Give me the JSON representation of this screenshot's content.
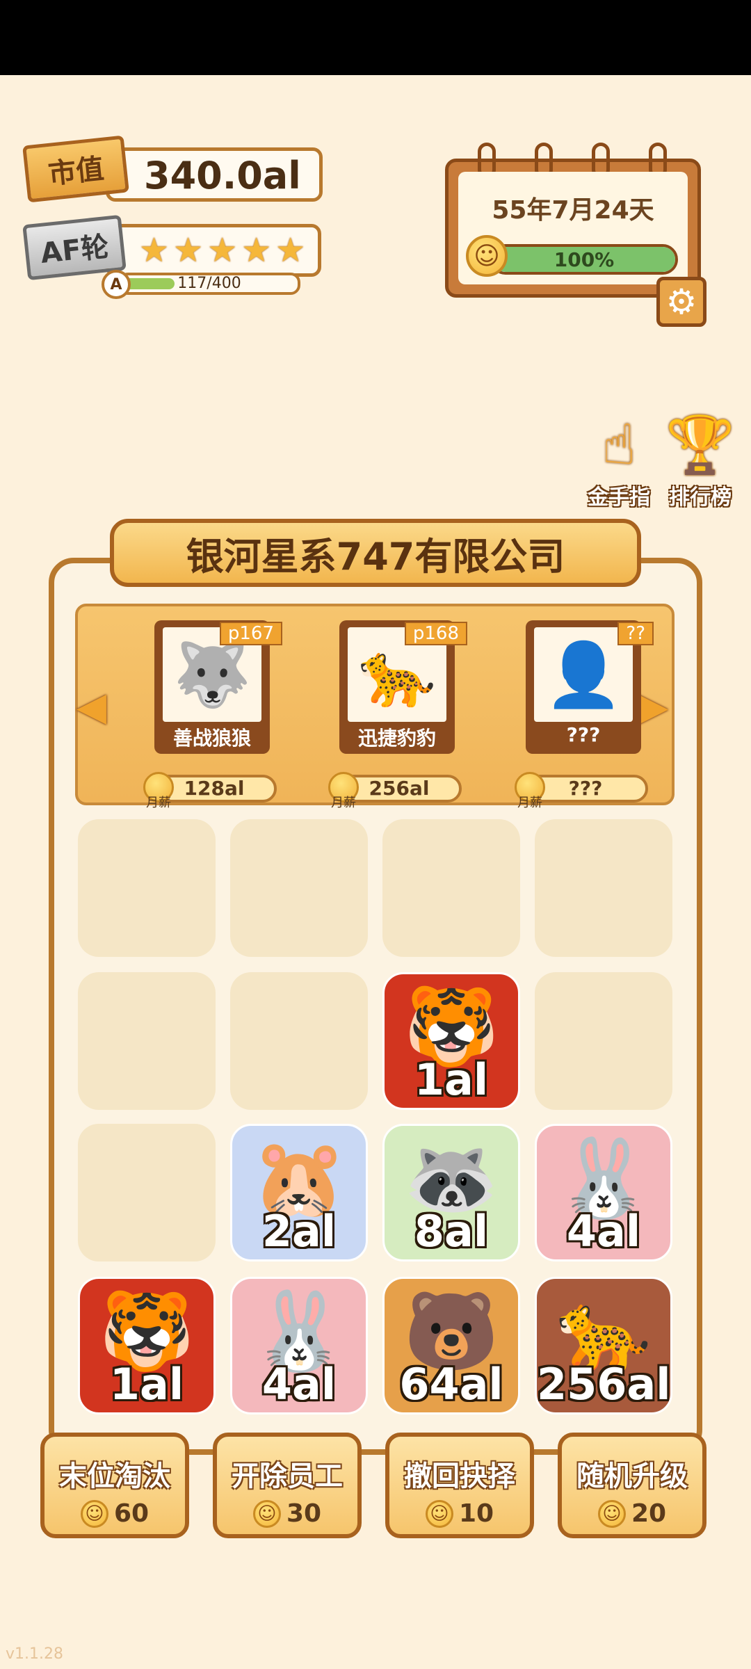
{
  "stats": {
    "market_label": "市值",
    "market_value": "340.0al",
    "round_label": "AF轮",
    "stars_filled": 5,
    "stars_total": 5,
    "level_letter": "A",
    "xp_text": "117/400",
    "xp_fraction": 0.2925
  },
  "calendar": {
    "date": "55年7月24天",
    "mood_text": "100%",
    "mood_fraction": 1.0
  },
  "side_buttons": [
    {
      "label": "金手指",
      "icon": "pointing-hand-icon"
    },
    {
      "label": "排行榜",
      "icon": "trophy-icon"
    }
  ],
  "company": {
    "name": "银河星系747有限公司"
  },
  "staff": [
    {
      "tag": "p167",
      "name": "善战狼狼",
      "pay_label": "月薪",
      "pay": "128al",
      "face": "🐺"
    },
    {
      "tag": "p168",
      "name": "迅捷豹豹",
      "pay_label": "月薪",
      "pay": "256al",
      "face": "🐆"
    },
    {
      "tag": "??",
      "name": "???",
      "pay_label": "月薪",
      "pay": "???",
      "face": "👤"
    }
  ],
  "grid": [
    [
      null,
      null,
      null,
      null
    ],
    [
      null,
      null,
      {
        "value": "1al",
        "face": "🐯",
        "color": "#d2351f"
      },
      null
    ],
    [
      null,
      {
        "value": "2al",
        "face": "🐹",
        "color": "#c9d8f4"
      },
      {
        "value": "8al",
        "face": "🦝",
        "color": "#d6ecc0"
      },
      {
        "value": "4al",
        "face": "🐰",
        "color": "#f4b8bc"
      }
    ],
    [
      {
        "value": "1al",
        "face": "🐯",
        "color": "#d2351f"
      },
      {
        "value": "4al",
        "face": "🐰",
        "color": "#f4b8bc"
      },
      {
        "value": "64al",
        "face": "🐻",
        "color": "#e6a04a"
      },
      {
        "value": "256al",
        "face": "🐆",
        "color": "#a85a3c"
      }
    ]
  ],
  "actions": [
    {
      "label": "末位淘汰",
      "cost": "60"
    },
    {
      "label": "开除员工",
      "cost": "30"
    },
    {
      "label": "撤回抉择",
      "cost": "10"
    },
    {
      "label": "随机升级",
      "cost": "20"
    }
  ],
  "version": "v1.1.28"
}
